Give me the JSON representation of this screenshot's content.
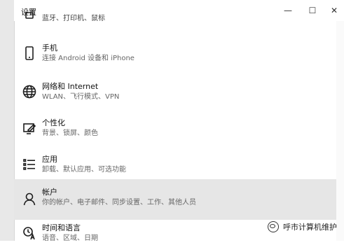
{
  "window": {
    "title": "设置",
    "controls": {
      "minimize": "—",
      "maximize": "☐",
      "close": "✕"
    }
  },
  "items": [
    {
      "icon": "printer-icon",
      "title": "",
      "subtitle": "蓝牙、打印机、鼠标"
    },
    {
      "icon": "phone-icon",
      "title": "手机",
      "subtitle": "连接 Android 设备和 iPhone"
    },
    {
      "icon": "globe-icon",
      "title": "网络和 Internet",
      "subtitle": "WLAN、飞行模式、VPN"
    },
    {
      "icon": "personalization-icon",
      "title": "个性化",
      "subtitle": "背景、锁屏、颜色"
    },
    {
      "icon": "apps-list-icon",
      "title": "应用",
      "subtitle": "卸载、默认应用、可选功能"
    },
    {
      "icon": "person-icon",
      "title": "帐户",
      "subtitle": "你的帐户、电子邮件、同步设置、工作、其他人员"
    },
    {
      "icon": "time-language-icon",
      "title": "时间和语言",
      "subtitle": "语音、区域、日期"
    }
  ],
  "watermark": {
    "text": "呼市计算机维护"
  }
}
